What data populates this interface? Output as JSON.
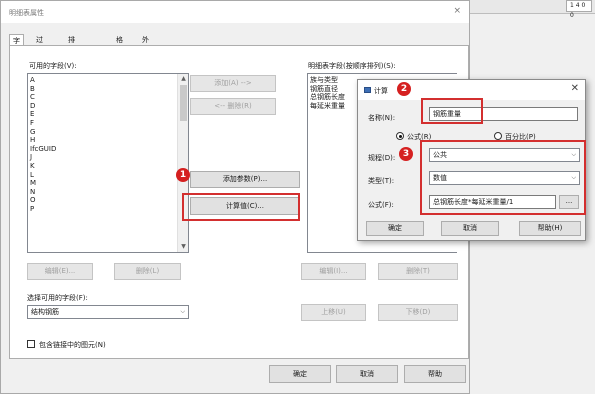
{
  "background_app": {
    "cell_text": "1 4 0 0"
  },
  "main_dialog": {
    "title": "明细表属性",
    "close_glyph": "×",
    "tabs": [
      "字段",
      "过滤器",
      "排序/成组",
      "格式",
      "外观"
    ],
    "available_fields_label": "可用的字段(V):",
    "available_fields": [
      "A",
      "B",
      "C",
      "D",
      "E",
      "F",
      "G",
      "H",
      "IfcGUID",
      "J",
      "K",
      "L",
      "M",
      "N",
      "O",
      "P"
    ],
    "add_button": "添加(A)  -->",
    "remove_button": "<-- 删除(R)",
    "add_parameter_button": "添加参数(P)...",
    "calculated_value_button": "计算值(C)...",
    "scheduled_fields_label": "明细表字段(按顺序排列)(S):",
    "scheduled_fields": [
      "族与类型",
      "钢筋直径",
      "总钢筋长度",
      "每延米重量"
    ],
    "edit_left_button": "编辑(E)...",
    "delete_left_button": "删除(L)",
    "edit_right_button": "编辑(I)...",
    "delete_right_button": "删除(T)",
    "select_fields_from_label": "选择可用的字段(F):",
    "select_fields_from_value": "结构钢筋",
    "move_up_button": "上移(U)",
    "move_down_button": "下移(D)",
    "include_linked_label": "包含链接中的图元(N)",
    "ok_button": "确定",
    "cancel_button": "取消",
    "help_button": "帮助"
  },
  "calc_dialog": {
    "title": "计算",
    "close_glyph": "✕",
    "name_label": "名称(N):",
    "name_value": "钢筋重量",
    "formula_radio": "公式(R)",
    "percentage_radio": "百分比(P)",
    "discipline_label": "规程(D):",
    "discipline_value": "公共",
    "type_label": "类型(T):",
    "type_value": "数值",
    "formula_label": "公式(F):",
    "formula_value": "总钢筋长度*每延米重量/1",
    "ellipsis": "...",
    "ok_button": "确定",
    "cancel_button": "取消",
    "help_button": "帮助(H)"
  },
  "annotations": {
    "badge1": "1",
    "badge2": "2",
    "badge3": "3",
    "highlight_color": "#d32f2f"
  },
  "icons": {
    "scroll_up": "▲",
    "scroll_down": "▼",
    "chevron": "⌵"
  }
}
